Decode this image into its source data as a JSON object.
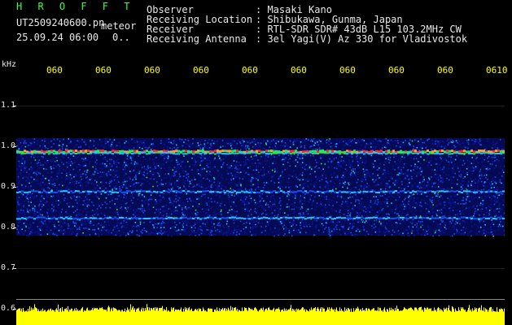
{
  "program": {
    "title": "H R O F F T"
  },
  "file": {
    "name": "UT2509240600.pn",
    "type": "meteor",
    "datetime": "25.09.24 06:00",
    "count": "0.."
  },
  "header": {
    "labels": [
      "Observer",
      "Receiving Location",
      "Receiver",
      "Receiving Antenna"
    ],
    "values": [
      ": Masaki Kano",
      ": Shibukawa, Gunma, Japan",
      ": RTL-SDR SDR# 43dB L15 103.2MHz CW",
      ": 3el Yagi(V) Az 330 for Vladivostok"
    ]
  },
  "axes": {
    "y_unit": "kHz",
    "y_ticks": [
      "1.1",
      "1.0",
      "0.9",
      "0.8",
      "0.7",
      "0.6"
    ],
    "time_ticks": [
      "060",
      "060",
      "060",
      "060",
      "060",
      "060",
      "060",
      "060",
      "060",
      "0610"
    ]
  },
  "spectrum": {
    "band_top_khz": 1.02,
    "band_bottom_khz": 0.78,
    "echo_lines_khz": [
      0.99,
      0.985,
      0.89,
      0.825
    ],
    "colors": {
      "noise": "#0a14a0",
      "mid": "#1ec8ff",
      "green": "#28e650",
      "hot": "#ff2a2a",
      "signal": "#ffff00"
    }
  }
}
